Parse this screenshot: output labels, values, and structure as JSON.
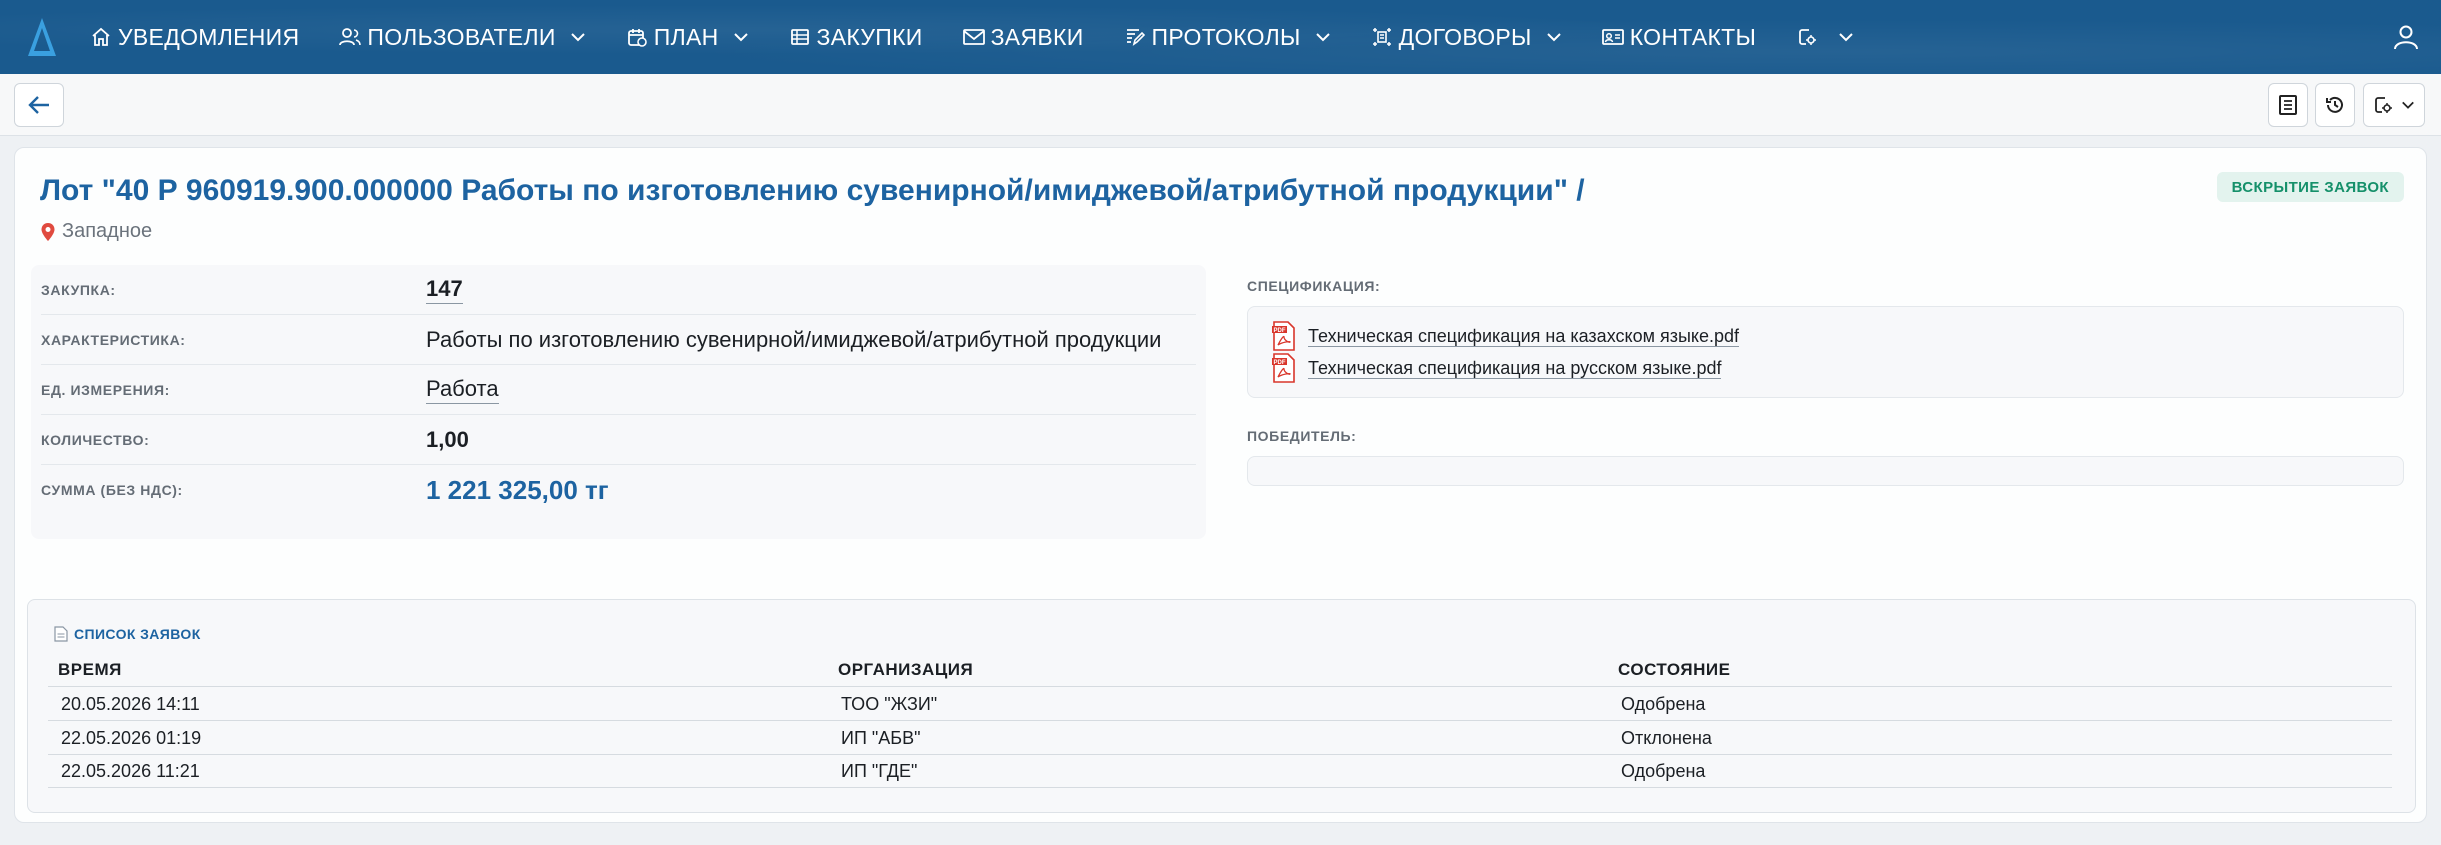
{
  "nav": {
    "items": [
      {
        "label": "УВЕДОМЛЕНИЯ",
        "icon": "home-icon",
        "dropdown": false
      },
      {
        "label": "ПОЛЬЗОВАТЕЛИ",
        "icon": "users-icon",
        "dropdown": true
      },
      {
        "label": "ПЛАН",
        "icon": "calendar-icon",
        "dropdown": true
      },
      {
        "label": "ЗАКУПКИ",
        "icon": "list-icon",
        "dropdown": false
      },
      {
        "label": "ЗАЯВКИ",
        "icon": "mail-icon",
        "dropdown": false
      },
      {
        "label": "ПРОТОКОЛЫ",
        "icon": "edit-document-icon",
        "dropdown": true
      },
      {
        "label": "ДОГОВОРЫ",
        "icon": "contract-icon",
        "dropdown": true
      },
      {
        "label": "КОНТАКТЫ",
        "icon": "contact-card-icon",
        "dropdown": false
      }
    ],
    "extra_menu_icon": "document-settings-icon",
    "user_icon": "user-icon",
    "colors": {
      "background": "#1a5a8e",
      "text": "#ffffff"
    }
  },
  "toolbar": {
    "back_icon": "arrow-left-icon",
    "right_icons": [
      "document-icon",
      "history-icon",
      "document-settings-icon"
    ]
  },
  "lot": {
    "title": "Лот \"40 Р 960919.900.000000 Работы по изготовлению сувенирной/имиджевой/атрибутной продукции\" /",
    "region": "Западное",
    "status": "ВСКРЫТИЕ ЗАЯВОК",
    "details": [
      {
        "label": "ЗАКУПКА:",
        "value": "147",
        "style": "link bold"
      },
      {
        "label": "ХАРАКТЕРИСТИКА:",
        "value": "Работы по изготовлению сувенирной/имиджевой/атрибутной продукции",
        "style": ""
      },
      {
        "label": "ЕД. ИЗМЕРЕНИЯ:",
        "value": "Работа",
        "style": "link"
      },
      {
        "label": "КОЛИЧЕСТВО:",
        "value": "1,00",
        "style": "bold"
      },
      {
        "label": "СУММА (БЕЗ НДС):",
        "value": "1 221 325,00 тг",
        "style": "sum"
      }
    ],
    "spec_label": "СПЕЦИФИКАЦИЯ:",
    "spec_files": [
      "Техническая спецификация на казахском языке.pdf",
      "Техническая спецификация на русском языке.pdf"
    ],
    "winner_label": "ПОБЕДИТЕЛЬ:",
    "winner_value": ""
  },
  "bids": {
    "title": "СПИСОК ЗАЯВОК",
    "columns": [
      "ВРЕМЯ",
      "ОРГАНИЗАЦИЯ",
      "СОСТОЯНИЕ"
    ],
    "rows": [
      [
        "20.05.2026 14:11",
        "ТОО \"ЖЗИ\"",
        "Одобрена"
      ],
      [
        "22.05.2026 01:19",
        "ИП \"АБВ\"",
        "Отклонена"
      ],
      [
        "22.05.2026 11:21",
        "ИП \"ГДЕ\"",
        "Одобрена"
      ]
    ]
  },
  "colors": {
    "accent": "#1d63a1",
    "status_bg": "#e3f3ee",
    "status_text": "#15906a",
    "pdf_red": "#d9362b"
  }
}
